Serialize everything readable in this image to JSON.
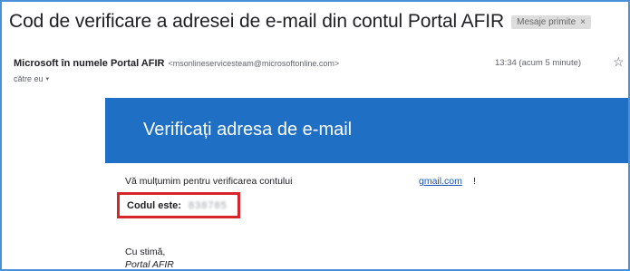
{
  "email": {
    "subject": "Cod de verificare a adresei de e-mail din contul Portal AFIR",
    "label_chip": "Mesaje primite",
    "label_close": "×",
    "sender_name": "Microsoft în numele Portal AFIR",
    "sender_email": "<msonlineservicesteam@microsoftonline.com>",
    "time": "13:34 (acum 5 minute)",
    "recipient": "către eu",
    "star_icon": "☆",
    "caret_icon": "▾"
  },
  "message": {
    "banner_title": "Verificați adresa de e-mail",
    "banner_color": "#1f6fc5",
    "thanks_text": "Vă mulțumim pentru verificarea contului",
    "email_link": "gmail.com",
    "exclamation": "!",
    "code_label": "Codul este:",
    "code_value": "838785",
    "code_highlight_color": "#d7262b",
    "closing": "Cu stimă,",
    "signature": "Portal AFIR"
  }
}
